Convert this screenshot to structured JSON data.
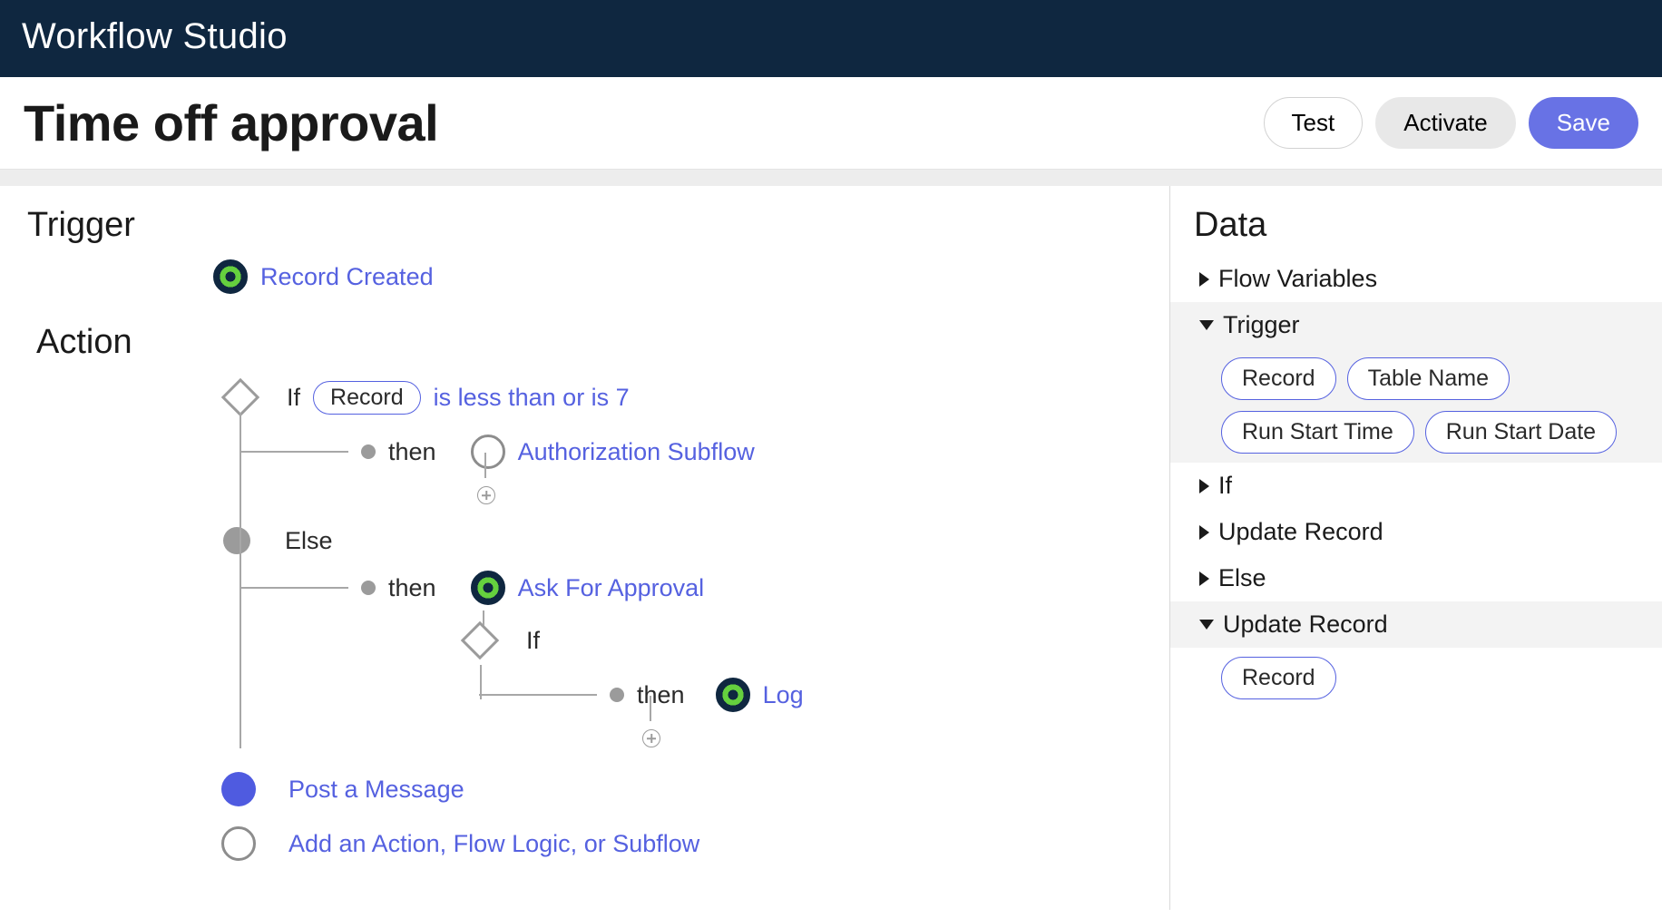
{
  "app_title": "Workflow Studio",
  "page_title": "Time off approval",
  "actions": {
    "test": "Test",
    "activate": "Activate",
    "save": "Save"
  },
  "canvas": {
    "trigger_heading": "Trigger",
    "action_heading": "Action",
    "trigger_name": "Record Created",
    "if_label": "If",
    "record_pill": "Record",
    "condition_suffix": "is less than or is 7",
    "then_label": "then",
    "else_label": "Else",
    "authorization_subflow": "Authorization Subflow",
    "ask_for_approval": "Ask For Approval",
    "nested_if_label": "If",
    "nested_then_label": "then",
    "log": "Log",
    "post_message": "Post a Message",
    "add_placeholder": "Add an Action, Flow Logic, or Subflow"
  },
  "data_panel": {
    "heading": "Data",
    "items": [
      {
        "label": "Flow Variables",
        "expanded": false,
        "pills": []
      },
      {
        "label": "Trigger",
        "expanded": true,
        "pills": [
          "Record",
          "Table Name",
          "Run Start Time",
          "Run Start Date"
        ]
      },
      {
        "label": "If",
        "expanded": false,
        "pills": []
      },
      {
        "label": "Update Record",
        "expanded": false,
        "pills": []
      },
      {
        "label": "Else",
        "expanded": false,
        "pills": []
      },
      {
        "label": "Update Record",
        "expanded": true,
        "pills": [
          "Record"
        ]
      }
    ]
  }
}
